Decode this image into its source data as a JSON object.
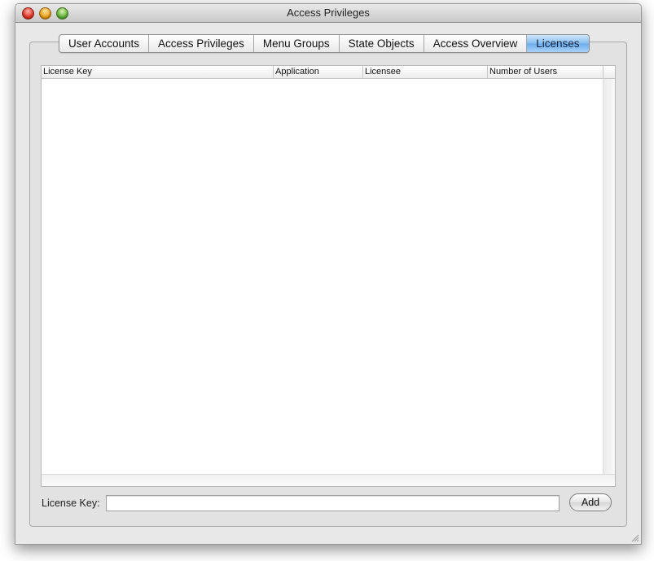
{
  "window": {
    "title": "Access Privileges"
  },
  "tabs": [
    {
      "label": "User Accounts"
    },
    {
      "label": "Access Privileges"
    },
    {
      "label": "Menu Groups"
    },
    {
      "label": "State Objects"
    },
    {
      "label": "Access Overview"
    },
    {
      "label": "Licenses",
      "selected": true
    }
  ],
  "table": {
    "columns": [
      "License Key",
      "Application",
      "Licensee",
      "Number of Users"
    ],
    "rows": []
  },
  "form": {
    "license_key_label": "License Key:",
    "license_key_value": "",
    "add_label": "Add"
  },
  "colors": {
    "selected_tab": "#86bdf0",
    "close": "#e0372a",
    "minimize": "#e9a21d",
    "zoom": "#66b23b"
  }
}
